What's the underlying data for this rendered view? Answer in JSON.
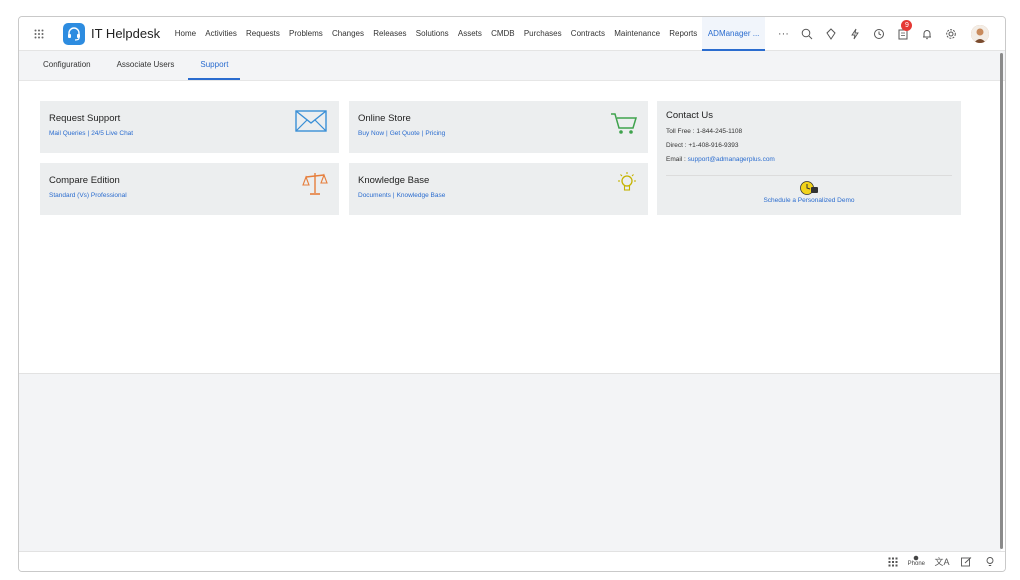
{
  "app": {
    "title": "IT Helpdesk"
  },
  "nav": {
    "items": [
      "Home",
      "Activities",
      "Requests",
      "Problems",
      "Changes",
      "Releases",
      "Solutions",
      "Assets",
      "CMDB",
      "Purchases",
      "Contracts",
      "Maintenance",
      "Reports"
    ],
    "active": "ADManager ...",
    "more": "···"
  },
  "notifications": {
    "count": "9"
  },
  "tabs": {
    "configuration": "Configuration",
    "associate_users": "Associate Users",
    "support": "Support"
  },
  "cards": {
    "request_support": {
      "title": "Request Support",
      "link1": "Mail Queries",
      "link2": "24/5 Live Chat",
      "icon": "mail-icon"
    },
    "online_store": {
      "title": "Online Store",
      "link1": "Buy Now",
      "link2": "Get Quote",
      "link3": "Pricing",
      "icon": "cart-icon"
    },
    "compare_edition": {
      "title": "Compare Edition",
      "link1": "Standard (Vs) Professional",
      "icon": "scale-icon"
    },
    "knowledge_base": {
      "title": "Knowledge Base",
      "link1": "Documents",
      "link2": "Knowledge Base",
      "icon": "lightbulb-icon"
    },
    "contact_us": {
      "title": "Contact Us",
      "toll_free": "Toll Free : 1-844-245-1108",
      "direct": "Direct : +1-408-916-9393",
      "email_label": "Email : ",
      "email": "support@admanagerplus.com",
      "demo": "Schedule a Personalized Demo"
    }
  },
  "bottombar": {
    "phone": "Phone",
    "lang": "文A"
  },
  "colors": {
    "accent": "#2a6ccf",
    "card_bg": "#eceeef",
    "mail_icon": "#3a8fd6",
    "cart_icon": "#3fa34d",
    "scale_icon": "#e67e3c",
    "bulb_icon": "#c5b300"
  }
}
